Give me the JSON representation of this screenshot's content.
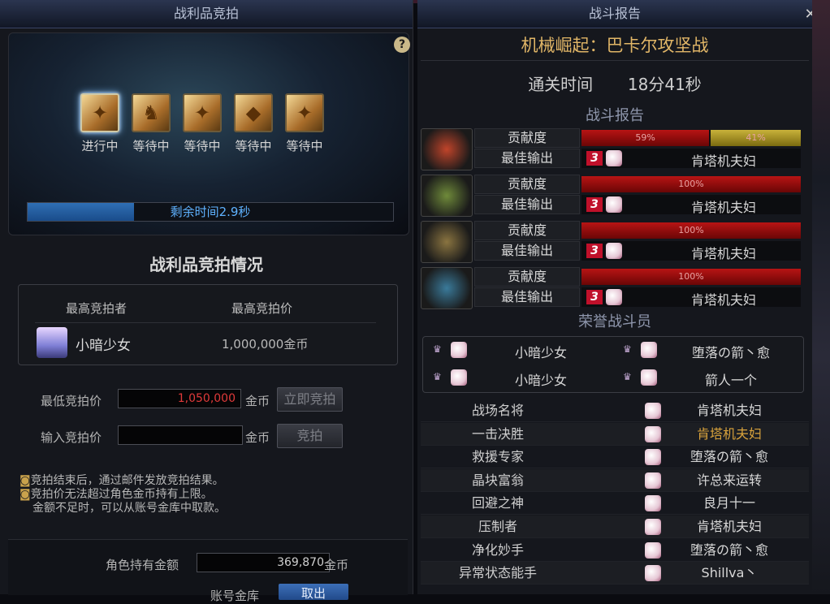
{
  "left": {
    "title": "战利品竞拍",
    "help": "?",
    "slots": [
      {
        "label": "进行中",
        "active": true,
        "glyph": "✦"
      },
      {
        "label": "等待中",
        "active": false,
        "glyph": "♞"
      },
      {
        "label": "等待中",
        "active": false,
        "glyph": "✦"
      },
      {
        "label": "等待中",
        "active": false,
        "glyph": "◆"
      },
      {
        "label": "等待中",
        "active": false,
        "glyph": "✦"
      }
    ],
    "timer_fraction": 0.29,
    "timer_text": "剩余时间2.9秒",
    "auction_heading": "战利品竞拍情况",
    "highest_bidder_header": "最高竞拍者",
    "highest_price_header": "最高竞拍价",
    "highest_bidder": "小暗少女",
    "highest_price": "1,000,000金币",
    "min_bid_label": "最低竞拍价",
    "min_bid_value": "1,050,000",
    "gold_unit": "金币",
    "buyout_button": "立即竞拍",
    "input_bid_label": "输入竞拍价",
    "input_bid_value": "",
    "bid_button": "竞拍",
    "notes": [
      "竞拍结束后，通过邮件发放竞拍结果。",
      "竞拍价无法超过角色金币持有上限。",
      "金额不足时，可以从账号金库中取款。"
    ],
    "char_gold_label": "角色持有金额",
    "char_gold_value": "369,870",
    "account_vault_label": "账号金库",
    "withdraw_button": "取出"
  },
  "right": {
    "title": "战斗报告",
    "close": "✕",
    "dungeon_name": "机械崛起：巴卡尔攻坚战",
    "clear_time_label": "通关时间",
    "clear_time_value": "18分41秒",
    "report_section": "战斗报告",
    "contribution_label": "贡献度",
    "best_dps_label": "最佳输出",
    "bosses": [
      {
        "icon_color": "#c0442a",
        "icon": "boss-fire-icon",
        "segments": [
          {
            "pct": 59,
            "text": "59%",
            "color": "red"
          },
          {
            "pct": 41,
            "text": "41%",
            "color": "gold"
          }
        ],
        "rank": "3",
        "best": "肯塔机夫妇"
      },
      {
        "icon_color": "#6f8a3a",
        "icon": "boss-green-icon",
        "segments": [
          {
            "pct": 100,
            "text": "100%",
            "color": "red"
          }
        ],
        "rank": "3",
        "best": "肯塔机夫妇"
      },
      {
        "icon_color": "#8a7440",
        "icon": "boss-gold-icon",
        "segments": [
          {
            "pct": 100,
            "text": "100%",
            "color": "red"
          }
        ],
        "rank": "3",
        "best": "肯塔机夫妇"
      },
      {
        "icon_color": "#3a7a9a",
        "icon": "boss-ice-icon",
        "segments": [
          {
            "pct": 100,
            "text": "100%",
            "color": "red"
          }
        ],
        "rank": "3",
        "best": "肯塔机夫妇"
      }
    ],
    "honor_section": "荣誉战斗员",
    "honor": [
      {
        "name": "小暗少女"
      },
      {
        "name": "堕落の箭丶愈"
      },
      {
        "name": "小暗少女"
      },
      {
        "name": "箭人一个"
      }
    ],
    "awards": [
      {
        "title": "战场名将",
        "player": "肯塔机夫妇",
        "gold": false
      },
      {
        "title": "一击决胜",
        "player": "肯塔机夫妇",
        "gold": true
      },
      {
        "title": "救援专家",
        "player": "堕落の箭丶愈",
        "gold": false
      },
      {
        "title": "晶块富翁",
        "player": "许总来运转",
        "gold": false
      },
      {
        "title": "回避之神",
        "player": "良月十一",
        "gold": false
      },
      {
        "title": "压制者",
        "player": "肯塔机夫妇",
        "gold": false
      },
      {
        "title": "净化妙手",
        "player": "堕落の箭丶愈",
        "gold": false
      },
      {
        "title": "异常状态能手",
        "player": "Shillva丶",
        "gold": false
      }
    ]
  },
  "colors": {
    "accent_gold": "#e1b667",
    "red_bar": "#b81414",
    "blue_timer": "#2f6fb5"
  }
}
